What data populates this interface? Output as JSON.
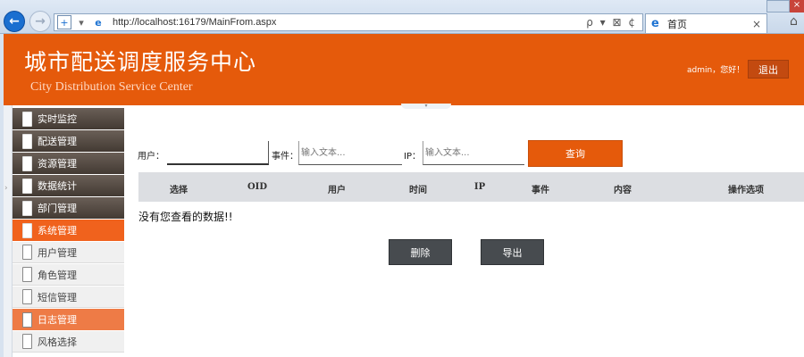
{
  "browser": {
    "url": "http://localhost:16179/MainFrom.aspx",
    "tab_title": "首页",
    "address_tools": "ρ ▾ ⊠ ¢",
    "close_glyph": "×"
  },
  "header": {
    "title": "城市配送调度服务中心",
    "subtitle": "City Distribution Service Center",
    "greeting": "admin，您好！",
    "logout_label": "退出",
    "accent_color": "#e55a0b"
  },
  "sidebar": {
    "items": [
      {
        "label": "实时监控",
        "icon": "monitor-icon",
        "state": "dark"
      },
      {
        "label": "配送管理",
        "icon": "delivery-icon",
        "state": "dark"
      },
      {
        "label": "资源管理",
        "icon": "resource-icon",
        "state": "dark"
      },
      {
        "label": "数据统计",
        "icon": "statistics-icon",
        "state": "dark"
      },
      {
        "label": "部门管理",
        "icon": "department-icon",
        "state": "dark"
      },
      {
        "label": "系统管理",
        "icon": "system-icon",
        "state": "active"
      },
      {
        "label": "用户管理",
        "icon": "user-icon",
        "state": "sub"
      },
      {
        "label": "角色管理",
        "icon": "role-icon",
        "state": "sub"
      },
      {
        "label": "短信管理",
        "icon": "sms-icon",
        "state": "sub"
      },
      {
        "label": "日志管理",
        "icon": "log-icon",
        "state": "sub-active"
      },
      {
        "label": "风格选择",
        "icon": "style-icon",
        "state": "sub"
      }
    ]
  },
  "search": {
    "user_label": "用户：",
    "user_value": "",
    "event_label": "事件：",
    "event_placeholder": "输入文本...",
    "ip_label": "IP：",
    "ip_placeholder": "输入文本...",
    "query_label": "查询"
  },
  "table": {
    "columns": [
      "选择",
      "OID",
      "用户",
      "时间",
      "IP",
      "事件",
      "内容",
      "操作选项"
    ],
    "empty_message": "没有您查看的数据!!"
  },
  "actions": {
    "delete_label": "删除",
    "export_label": "导出"
  }
}
